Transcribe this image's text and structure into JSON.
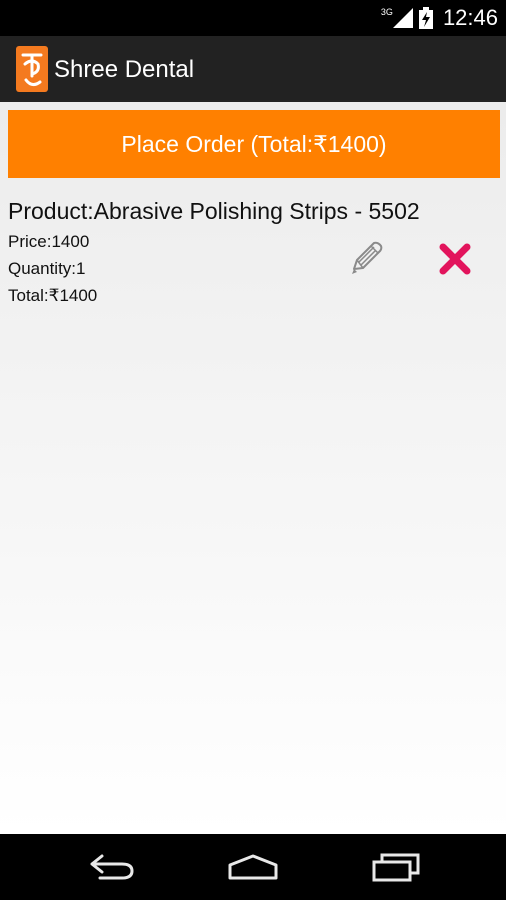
{
  "status_bar": {
    "network_type": "3G",
    "time": "12:46",
    "icons": [
      "signal-icon",
      "battery-charging-icon"
    ]
  },
  "app": {
    "title": "Shree Dental",
    "logo_icon": "shree-logo-icon",
    "brand_color": "#ff8000"
  },
  "order": {
    "button_label": "Place Order (Total:₹1400)"
  },
  "cart_items": [
    {
      "product": "Product:Abrasive Polishing Strips - 5502",
      "price": "Price:1400",
      "quantity": "Quantity:1",
      "total": "Total:₹1400",
      "edit_icon": "pencil-icon",
      "delete_icon": "close-icon",
      "delete_color": "#e2145c"
    }
  ],
  "nav_bar": {
    "icons": [
      "back-icon",
      "home-icon",
      "recent-apps-icon"
    ]
  }
}
